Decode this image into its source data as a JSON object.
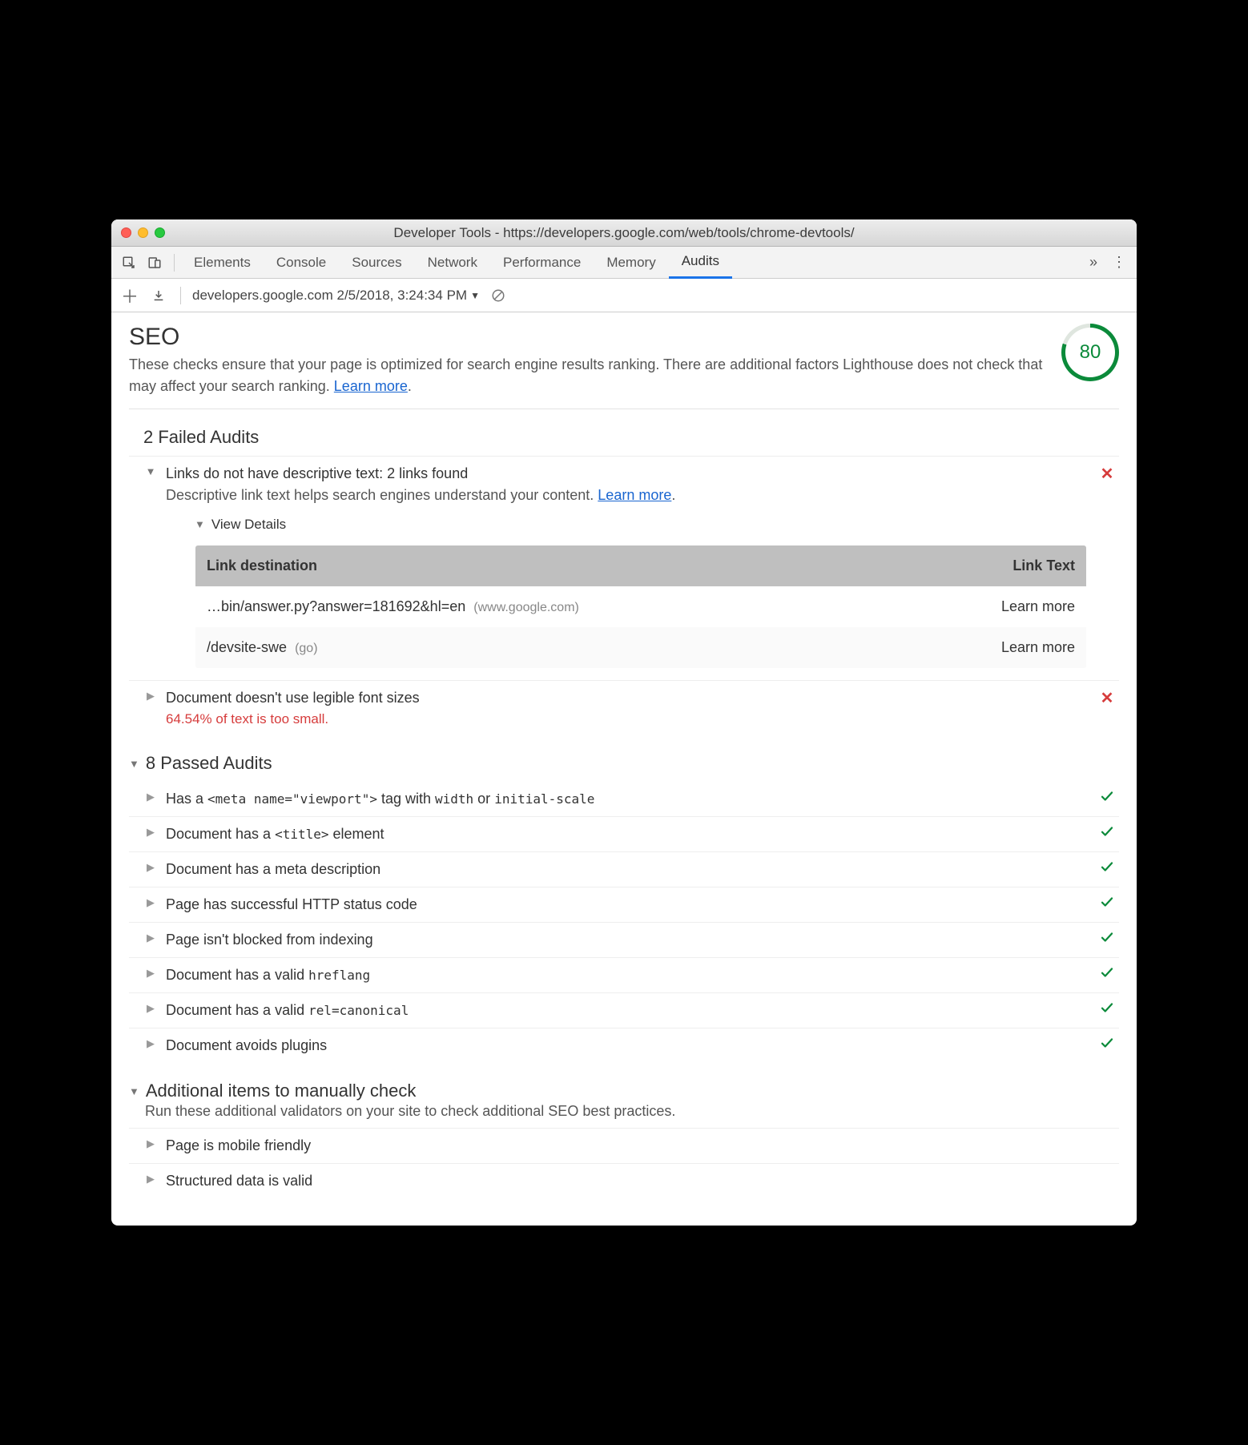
{
  "window": {
    "title": "Developer Tools - https://developers.google.com/web/tools/chrome-devtools/"
  },
  "tabs": {
    "items": [
      "Elements",
      "Console",
      "Sources",
      "Network",
      "Performance",
      "Memory",
      "Audits"
    ],
    "active": "Audits"
  },
  "subbar": {
    "run_label": "developers.google.com 2/5/2018, 3:24:34 PM"
  },
  "seo": {
    "title": "SEO",
    "description_a": "These checks ensure that your page is optimized for search engine results ranking. There are additional factors Lighthouse does not check that may affect your search ranking. ",
    "learn_more": "Learn more",
    "score": "80"
  },
  "failed": {
    "title": "2 Failed Audits",
    "items": [
      {
        "title": "Links do not have descriptive text: 2 links found",
        "sub_a": "Descriptive link text helps search engines understand your content. ",
        "learn_more": "Learn more",
        "expanded": true,
        "details": {
          "label": "View Details",
          "columns": [
            "Link destination",
            "Link Text"
          ],
          "rows": [
            {
              "dest": "…bin/answer.py?answer=181692&hl=en",
              "host": "(www.google.com)",
              "text": "Learn more"
            },
            {
              "dest": "/devsite-swe",
              "host": "(go)",
              "text": "Learn more"
            }
          ]
        }
      },
      {
        "title": "Document doesn't use legible font sizes",
        "sub_red": "64.54% of text is too small.",
        "expanded": false
      }
    ]
  },
  "passed": {
    "title": "8 Passed Audits",
    "items": [
      {
        "pre": "Has a ",
        "code": "<meta name=\"viewport\">",
        "mid": " tag with ",
        "code2": "width",
        "mid2": " or ",
        "code3": "initial-scale"
      },
      {
        "pre": "Document has a ",
        "code": "<title>",
        "mid": " element"
      },
      {
        "pre": "Document has a meta description"
      },
      {
        "pre": "Page has successful HTTP status code"
      },
      {
        "pre": "Page isn't blocked from indexing"
      },
      {
        "pre": "Document has a valid ",
        "code": "hreflang"
      },
      {
        "pre": "Document has a valid ",
        "code": "rel=canonical"
      },
      {
        "pre": "Document avoids plugins"
      }
    ]
  },
  "manual": {
    "title": "Additional items to manually check",
    "desc": "Run these additional validators on your site to check additional SEO best practices.",
    "items": [
      {
        "title": "Page is mobile friendly"
      },
      {
        "title": "Structured data is valid"
      }
    ]
  }
}
